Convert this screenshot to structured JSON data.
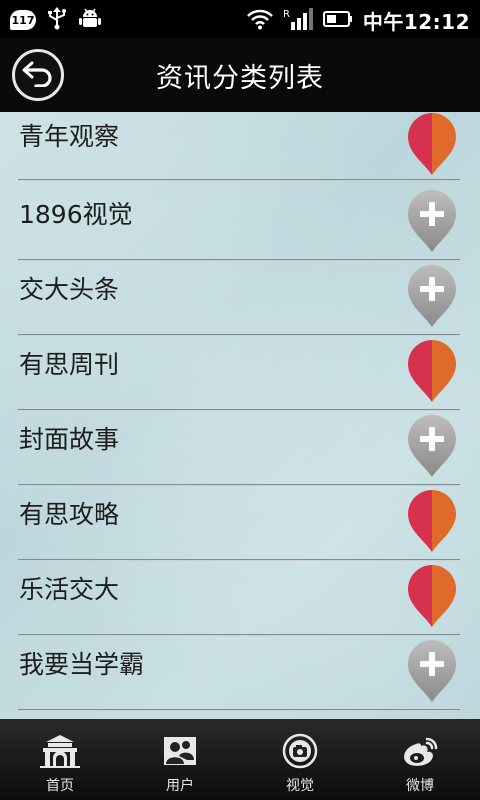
{
  "status_bar": {
    "notification_count": "117",
    "time": "中午12:12"
  },
  "header": {
    "title": "资讯分类列表",
    "back_icon": "back-arrow-icon"
  },
  "categories": [
    {
      "label": "青年观察",
      "subscribed": true
    },
    {
      "label": "1896视觉",
      "subscribed": false
    },
    {
      "label": "交大头条",
      "subscribed": false
    },
    {
      "label": "有思周刊",
      "subscribed": true
    },
    {
      "label": "封面故事",
      "subscribed": false
    },
    {
      "label": "有思攻略",
      "subscribed": true
    },
    {
      "label": "乐活交大",
      "subscribed": true
    },
    {
      "label": "我要当学霸",
      "subscribed": false
    }
  ],
  "tabs": [
    {
      "label": "首页",
      "icon": "gate-icon"
    },
    {
      "label": "用户",
      "icon": "users-icon"
    },
    {
      "label": "视觉",
      "icon": "camera-icon"
    },
    {
      "label": "微博",
      "icon": "weibo-icon"
    }
  ],
  "colors": {
    "pin_red": "#d6314e",
    "pin_orange": "#df6a2a",
    "pin_gray": "#9c9c9c"
  }
}
